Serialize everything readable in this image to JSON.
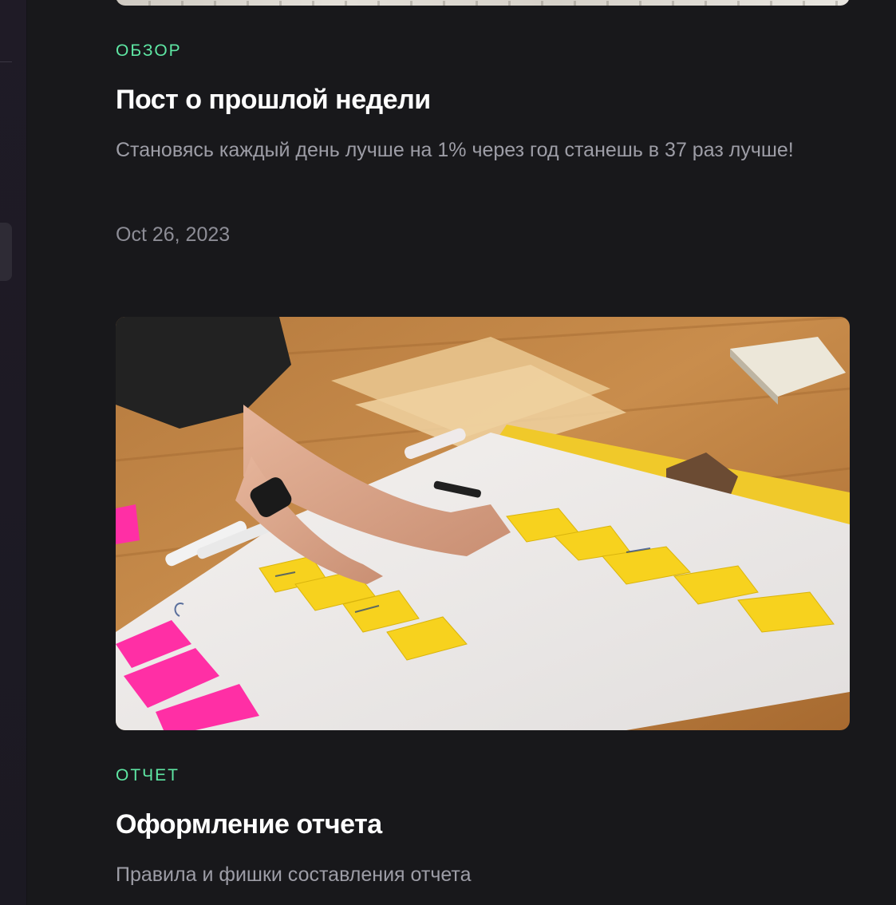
{
  "posts": [
    {
      "category": "ОБЗОР",
      "title": "Пост о прошлой недели",
      "excerpt": "Становясь каждый день лучше на 1% через год станешь в 37 раз лучше!",
      "date": "Oct 26, 2023"
    },
    {
      "category": "ОТЧЕТ",
      "title": "Оформление отчета",
      "excerpt": "Правила и фишки составления отчета"
    }
  ],
  "colors": {
    "background": "#18181b",
    "category": "#5ee6a3",
    "title": "#ffffff",
    "excerpt": "#9d9da6"
  }
}
